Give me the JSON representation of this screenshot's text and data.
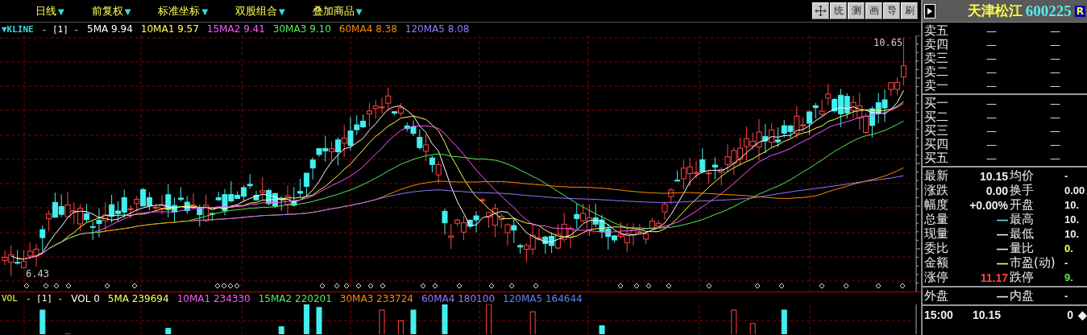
{
  "menu": [
    {
      "label": "日线",
      "caret": "▼"
    },
    {
      "label": "前复权",
      "caret": "▼"
    },
    {
      "label": "标准坐标",
      "caret": "▼"
    },
    {
      "label": "双股组合",
      "caret": "▼"
    },
    {
      "label": "叠加商品",
      "caret": "▼"
    }
  ],
  "toolbar": [
    {
      "kind": "pan"
    },
    {
      "kind": "text",
      "label": "统"
    },
    {
      "kind": "text",
      "label": "测"
    },
    {
      "kind": "text",
      "label": "画"
    },
    {
      "kind": "text",
      "label": "导"
    },
    {
      "kind": "text",
      "label": "刷"
    }
  ],
  "stock": {
    "name": "天津松江",
    "code": "600225",
    "badge": "R"
  },
  "kline_legend": {
    "name": "▼KLINE",
    "params": "- [1] -",
    "averages": [
      {
        "label": "5MA 9.94",
        "color": "#ffffff"
      },
      {
        "label": "10MA1 9.57",
        "color": "#ffff55"
      },
      {
        "label": "15MA2 9.41",
        "color": "#ff55ff"
      },
      {
        "label": "30MA3 9.10",
        "color": "#55ee55"
      },
      {
        "label": "60MA4 8.38",
        "color": "#ff8800"
      },
      {
        "label": "120MA5 8.08",
        "color": "#9977ff"
      }
    ]
  },
  "price_labels": {
    "high": "10.65",
    "low": "6.43"
  },
  "vol_legend": {
    "name": "VOL",
    "params": "- [1] -",
    "averages": [
      {
        "label": "VOL 0",
        "color": "#ffffff"
      },
      {
        "label": "5MA 239694",
        "color": "#ffff55"
      },
      {
        "label": "10MA1 234330",
        "color": "#ff55ff"
      },
      {
        "label": "15MA2 220201",
        "color": "#55ee55"
      },
      {
        "label": "30MA3 233724",
        "color": "#ff8800"
      },
      {
        "label": "60MA4 180100",
        "color": "#9977ff"
      },
      {
        "label": "120MA5 164644",
        "color": "#5588ff"
      }
    ]
  },
  "asks": [
    {
      "label": "卖五",
      "price": "—",
      "volume": "—"
    },
    {
      "label": "卖四",
      "price": "—",
      "volume": "—"
    },
    {
      "label": "卖三",
      "price": "—",
      "volume": "—"
    },
    {
      "label": "卖二",
      "price": "—",
      "volume": "—"
    },
    {
      "label": "卖一",
      "price": "—",
      "volume": "—"
    }
  ],
  "bids": [
    {
      "label": "买一",
      "price": "—",
      "volume": "—"
    },
    {
      "label": "买二",
      "price": "—",
      "volume": "—"
    },
    {
      "label": "买三",
      "price": "—",
      "volume": "—"
    },
    {
      "label": "买四",
      "price": "—",
      "volume": "—"
    },
    {
      "label": "买五",
      "price": "—",
      "volume": "—"
    }
  ],
  "quote": [
    {
      "left": {
        "label": "最新",
        "value": "10.15"
      },
      "right": {
        "label": "均价",
        "value": "-"
      }
    },
    {
      "left": {
        "label": "涨跌",
        "value": "0.00"
      },
      "right": {
        "label": "换手",
        "value": "0.00"
      }
    },
    {
      "left": {
        "label": "幅度",
        "value": "+0.00%"
      },
      "right": {
        "label": "开盘",
        "value": "10."
      }
    },
    {
      "left": {
        "label": "总量",
        "value": "—",
        "color": "#55eeee"
      },
      "right": {
        "label": "最高",
        "value": "10."
      }
    },
    {
      "left": {
        "label": "现量",
        "value": "—"
      },
      "right": {
        "label": "最低",
        "value": "10."
      }
    },
    {
      "left": {
        "label": "委比",
        "value": "—"
      },
      "right": {
        "label": "量比",
        "value": "0.",
        "color": "#ffff55"
      }
    },
    {
      "left": {
        "label": "金额",
        "value": "—",
        "color": "#ffff55"
      },
      "right": {
        "label": "市盈(动)",
        "value": "-"
      }
    },
    {
      "left": {
        "label": "涨停",
        "value": "11.17",
        "color": "#ff4444"
      },
      "right": {
        "label": "跌停",
        "value": "9.",
        "color": "#55ee55"
      }
    }
  ],
  "outer": {
    "left": {
      "label": "外盘",
      "value": "—"
    },
    "right": {
      "label": "内盘",
      "value": "-"
    }
  },
  "tick": {
    "time": "15:00",
    "price": "10.15",
    "volume": "0",
    "mark": "◆"
  }
}
